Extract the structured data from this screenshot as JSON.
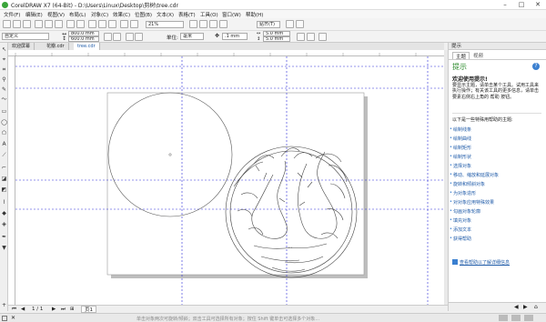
{
  "window": {
    "title": "CorelDRAW X7 (64-Bit) - D:\\Users\\Linux\\Desktop\\剪树\\tree.cdr",
    "minimize": "–",
    "maximize": "□",
    "close": "✕"
  },
  "menu": [
    "文件(F)",
    "编辑(E)",
    "视图(V)",
    "布局(L)",
    "对象(C)",
    "效果(C)",
    "位图(B)",
    "文本(X)",
    "表格(T)",
    "工具(O)",
    "窗口(W)",
    "帮助(H)"
  ],
  "toolbar": {
    "zoom": "21%",
    "snap_label": "贴齐(T)"
  },
  "property_bar": {
    "preset": "自定义",
    "width": "800.0 mm",
    "height": "600.0 mm",
    "units_label": "单位:",
    "units": "毫米",
    "nudge": ".1 mm",
    "dup_x": "5.0 mm",
    "dup_y": "5.0 mm"
  },
  "tabs": [
    "欢迎屏幕",
    "花瓣.cdr",
    "tree.cdr"
  ],
  "page_nav": {
    "current": "1 / 1",
    "page_tab": "页1"
  },
  "statusbar_hint": "单击对象两次可旋转/倾斜；双击工具可选择所有对象；按住 Shift 键单击可选择多个对象…",
  "panel": {
    "header": "提示",
    "tabs": [
      "主题",
      "视频"
    ],
    "title": "提示",
    "welcome": "欢迎使用提示!",
    "body": "要显示主题，请单击某个工具。试用工具来执行操作；有关该工具的更多信息，请单击要素右侧右上角的 帮助 按钮。",
    "list_intro": "以下是一些特殊用帮助的主题:",
    "links": [
      "绘制线条",
      "绘制曲线",
      "绘制矩形",
      "绘制形状",
      "选择对象",
      "移动、缩放和延展对象",
      "旋转和倾斜对象",
      "为对象造形",
      "对对象应用特殊效果",
      "勾画对象轮廓",
      "填充对象",
      "添加文本",
      "获得帮助"
    ],
    "footer_link": "查看帮助以了解详细信息"
  },
  "colors": {
    "accent": "#1e5aa8",
    "guide": "#2a2ad8",
    "panel_title": "#2e8b2e"
  }
}
